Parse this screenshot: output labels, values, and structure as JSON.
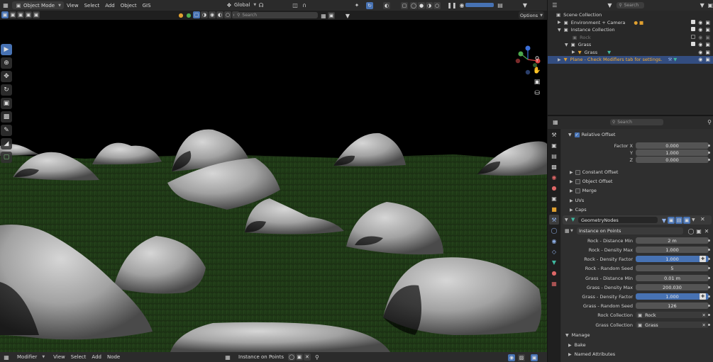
{
  "header": {
    "mode_label": "Object Mode",
    "menus": [
      "View",
      "Select",
      "Add",
      "Object",
      "GIS"
    ],
    "transform_orientation": "Global",
    "options_label": "Options"
  },
  "viewport_header": {
    "search_placeholder": "Search"
  },
  "bottom_bar": {
    "editor_label": "Modifier",
    "menus": [
      "View",
      "Select",
      "Add",
      "Node"
    ],
    "node_group": "Instance on Points"
  },
  "outliner": {
    "search_placeholder": "Search",
    "rows": [
      {
        "label": "Scene Collection",
        "indent": 0
      },
      {
        "label": "Environment + Camera",
        "indent": 1
      },
      {
        "label": "Instance Collection",
        "indent": 1
      },
      {
        "label": "Rock",
        "indent": 2
      },
      {
        "label": "Grass",
        "indent": 2
      },
      {
        "label": "Grass",
        "indent": 3
      },
      {
        "label": "Plane - Check Modifiers tab for settings.",
        "indent": 1
      }
    ]
  },
  "properties": {
    "search_placeholder": "Search",
    "relative_offset_label": "Relative Offset",
    "factor_rows": [
      {
        "label": "Factor X",
        "value": "0.000"
      },
      {
        "label": "Y",
        "value": "1.000"
      },
      {
        "label": "Z",
        "value": "0.000"
      }
    ],
    "array_panels": [
      "Constant Offset",
      "Object Offset",
      "Merge",
      "UVs",
      "Caps"
    ],
    "modifier_name": "GeometryNodes",
    "node_group": "Instance on Points",
    "inputs": [
      {
        "label": "Rock - Distance Min",
        "value": "2 m",
        "highlight": false
      },
      {
        "label": "Rock - Density Max",
        "value": "1.000",
        "highlight": false
      },
      {
        "label": "Rock - Density Factor",
        "value": "1.000",
        "highlight": true
      },
      {
        "label": "Rock - Random Seed",
        "value": "5",
        "highlight": false
      },
      {
        "label": "Grass - Distance Min",
        "value": "0.01 m",
        "highlight": false
      },
      {
        "label": "Grass - Density Max",
        "value": "200.030",
        "highlight": false
      },
      {
        "label": "Grass - Density Factor",
        "value": "1.000",
        "highlight": true
      },
      {
        "label": "Grass - Random Seed",
        "value": "126",
        "highlight": false
      }
    ],
    "collections": [
      {
        "label": "Rock Collection",
        "value": "Rock"
      },
      {
        "label": "Grass Collection",
        "value": "Grass"
      }
    ],
    "footer_panels": [
      "Manage",
      "Bake",
      "Named Attributes"
    ]
  },
  "colors": {
    "accent": "#4772b3",
    "selection": "#334d80",
    "active_text": "#ffaf29"
  }
}
